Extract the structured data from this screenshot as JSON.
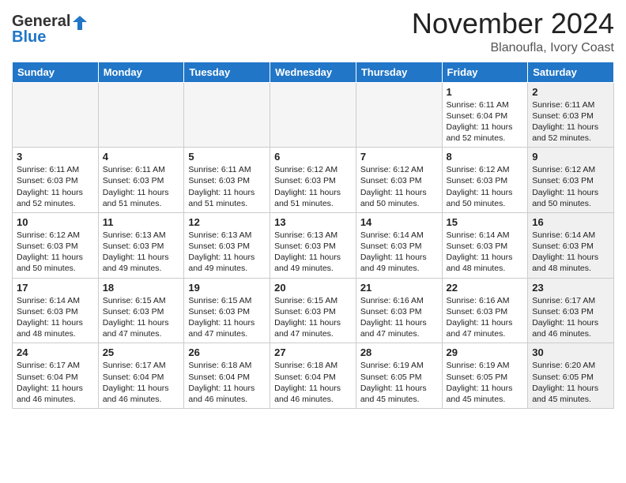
{
  "header": {
    "logo_general": "General",
    "logo_blue": "Blue",
    "month_title": "November 2024",
    "location": "Blanoufla, Ivory Coast"
  },
  "weekdays": [
    "Sunday",
    "Monday",
    "Tuesday",
    "Wednesday",
    "Thursday",
    "Friday",
    "Saturday"
  ],
  "weeks": [
    [
      {
        "day": "",
        "empty": true
      },
      {
        "day": "",
        "empty": true
      },
      {
        "day": "",
        "empty": true
      },
      {
        "day": "",
        "empty": true
      },
      {
        "day": "",
        "empty": true
      },
      {
        "day": "1",
        "sunrise": "Sunrise: 6:11 AM",
        "sunset": "Sunset: 6:04 PM",
        "daylight": "Daylight: 11 hours and 52 minutes.",
        "shaded": false
      },
      {
        "day": "2",
        "sunrise": "Sunrise: 6:11 AM",
        "sunset": "Sunset: 6:03 PM",
        "daylight": "Daylight: 11 hours and 52 minutes.",
        "shaded": true
      }
    ],
    [
      {
        "day": "3",
        "sunrise": "Sunrise: 6:11 AM",
        "sunset": "Sunset: 6:03 PM",
        "daylight": "Daylight: 11 hours and 52 minutes.",
        "shaded": false
      },
      {
        "day": "4",
        "sunrise": "Sunrise: 6:11 AM",
        "sunset": "Sunset: 6:03 PM",
        "daylight": "Daylight: 11 hours and 51 minutes.",
        "shaded": false
      },
      {
        "day": "5",
        "sunrise": "Sunrise: 6:11 AM",
        "sunset": "Sunset: 6:03 PM",
        "daylight": "Daylight: 11 hours and 51 minutes.",
        "shaded": false
      },
      {
        "day": "6",
        "sunrise": "Sunrise: 6:12 AM",
        "sunset": "Sunset: 6:03 PM",
        "daylight": "Daylight: 11 hours and 51 minutes.",
        "shaded": false
      },
      {
        "day": "7",
        "sunrise": "Sunrise: 6:12 AM",
        "sunset": "Sunset: 6:03 PM",
        "daylight": "Daylight: 11 hours and 50 minutes.",
        "shaded": false
      },
      {
        "day": "8",
        "sunrise": "Sunrise: 6:12 AM",
        "sunset": "Sunset: 6:03 PM",
        "daylight": "Daylight: 11 hours and 50 minutes.",
        "shaded": false
      },
      {
        "day": "9",
        "sunrise": "Sunrise: 6:12 AM",
        "sunset": "Sunset: 6:03 PM",
        "daylight": "Daylight: 11 hours and 50 minutes.",
        "shaded": true
      }
    ],
    [
      {
        "day": "10",
        "sunrise": "Sunrise: 6:12 AM",
        "sunset": "Sunset: 6:03 PM",
        "daylight": "Daylight: 11 hours and 50 minutes.",
        "shaded": false
      },
      {
        "day": "11",
        "sunrise": "Sunrise: 6:13 AM",
        "sunset": "Sunset: 6:03 PM",
        "daylight": "Daylight: 11 hours and 49 minutes.",
        "shaded": false
      },
      {
        "day": "12",
        "sunrise": "Sunrise: 6:13 AM",
        "sunset": "Sunset: 6:03 PM",
        "daylight": "Daylight: 11 hours and 49 minutes.",
        "shaded": false
      },
      {
        "day": "13",
        "sunrise": "Sunrise: 6:13 AM",
        "sunset": "Sunset: 6:03 PM",
        "daylight": "Daylight: 11 hours and 49 minutes.",
        "shaded": false
      },
      {
        "day": "14",
        "sunrise": "Sunrise: 6:14 AM",
        "sunset": "Sunset: 6:03 PM",
        "daylight": "Daylight: 11 hours and 49 minutes.",
        "shaded": false
      },
      {
        "day": "15",
        "sunrise": "Sunrise: 6:14 AM",
        "sunset": "Sunset: 6:03 PM",
        "daylight": "Daylight: 11 hours and 48 minutes.",
        "shaded": false
      },
      {
        "day": "16",
        "sunrise": "Sunrise: 6:14 AM",
        "sunset": "Sunset: 6:03 PM",
        "daylight": "Daylight: 11 hours and 48 minutes.",
        "shaded": true
      }
    ],
    [
      {
        "day": "17",
        "sunrise": "Sunrise: 6:14 AM",
        "sunset": "Sunset: 6:03 PM",
        "daylight": "Daylight: 11 hours and 48 minutes.",
        "shaded": false
      },
      {
        "day": "18",
        "sunrise": "Sunrise: 6:15 AM",
        "sunset": "Sunset: 6:03 PM",
        "daylight": "Daylight: 11 hours and 47 minutes.",
        "shaded": false
      },
      {
        "day": "19",
        "sunrise": "Sunrise: 6:15 AM",
        "sunset": "Sunset: 6:03 PM",
        "daylight": "Daylight: 11 hours and 47 minutes.",
        "shaded": false
      },
      {
        "day": "20",
        "sunrise": "Sunrise: 6:15 AM",
        "sunset": "Sunset: 6:03 PM",
        "daylight": "Daylight: 11 hours and 47 minutes.",
        "shaded": false
      },
      {
        "day": "21",
        "sunrise": "Sunrise: 6:16 AM",
        "sunset": "Sunset: 6:03 PM",
        "daylight": "Daylight: 11 hours and 47 minutes.",
        "shaded": false
      },
      {
        "day": "22",
        "sunrise": "Sunrise: 6:16 AM",
        "sunset": "Sunset: 6:03 PM",
        "daylight": "Daylight: 11 hours and 47 minutes.",
        "shaded": false
      },
      {
        "day": "23",
        "sunrise": "Sunrise: 6:17 AM",
        "sunset": "Sunset: 6:03 PM",
        "daylight": "Daylight: 11 hours and 46 minutes.",
        "shaded": true
      }
    ],
    [
      {
        "day": "24",
        "sunrise": "Sunrise: 6:17 AM",
        "sunset": "Sunset: 6:04 PM",
        "daylight": "Daylight: 11 hours and 46 minutes.",
        "shaded": false
      },
      {
        "day": "25",
        "sunrise": "Sunrise: 6:17 AM",
        "sunset": "Sunset: 6:04 PM",
        "daylight": "Daylight: 11 hours and 46 minutes.",
        "shaded": false
      },
      {
        "day": "26",
        "sunrise": "Sunrise: 6:18 AM",
        "sunset": "Sunset: 6:04 PM",
        "daylight": "Daylight: 11 hours and 46 minutes.",
        "shaded": false
      },
      {
        "day": "27",
        "sunrise": "Sunrise: 6:18 AM",
        "sunset": "Sunset: 6:04 PM",
        "daylight": "Daylight: 11 hours and 46 minutes.",
        "shaded": false
      },
      {
        "day": "28",
        "sunrise": "Sunrise: 6:19 AM",
        "sunset": "Sunset: 6:05 PM",
        "daylight": "Daylight: 11 hours and 45 minutes.",
        "shaded": false
      },
      {
        "day": "29",
        "sunrise": "Sunrise: 6:19 AM",
        "sunset": "Sunset: 6:05 PM",
        "daylight": "Daylight: 11 hours and 45 minutes.",
        "shaded": false
      },
      {
        "day": "30",
        "sunrise": "Sunrise: 6:20 AM",
        "sunset": "Sunset: 6:05 PM",
        "daylight": "Daylight: 11 hours and 45 minutes.",
        "shaded": true
      }
    ]
  ]
}
